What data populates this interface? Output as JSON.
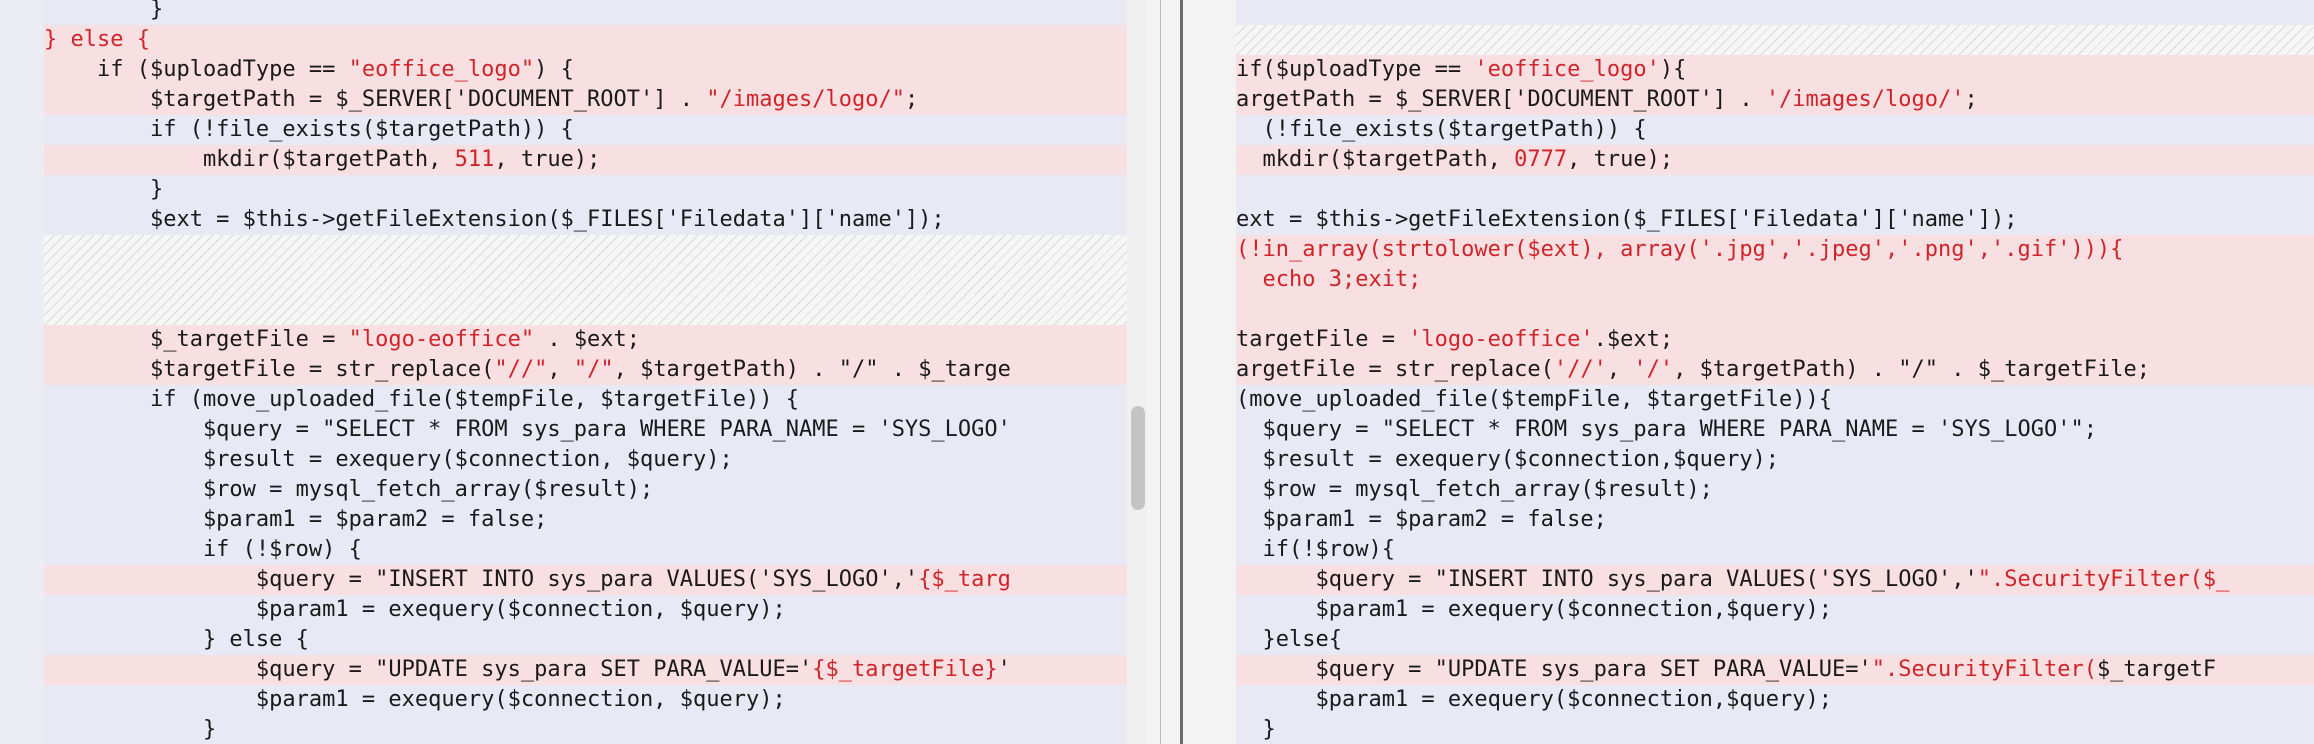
{
  "left": {
    "lines": [
      {
        "type": "plain",
        "segments": [
          {
            "t": "        }"
          }
        ]
      },
      {
        "type": "changed",
        "segments": [
          {
            "t": "} else {",
            "c": "r"
          }
        ]
      },
      {
        "type": "changed",
        "segments": [
          {
            "t": "    if ($uploadType == "
          },
          {
            "t": "\"eoffice_logo\"",
            "c": "r"
          },
          {
            "t": ") {"
          }
        ]
      },
      {
        "type": "changed",
        "segments": [
          {
            "t": "        $targetPath = $_SERVER['DOCUMENT_ROOT'] . "
          },
          {
            "t": "\"/images/logo/\"",
            "c": "r"
          },
          {
            "t": ";"
          }
        ]
      },
      {
        "type": "plain",
        "segments": [
          {
            "t": "        if (!file_exists($targetPath)) {"
          }
        ]
      },
      {
        "type": "changed",
        "segments": [
          {
            "t": "            mkdir($targetPath, "
          },
          {
            "t": "511",
            "c": "r"
          },
          {
            "t": ", true);"
          }
        ]
      },
      {
        "type": "plain",
        "segments": [
          {
            "t": "        }"
          }
        ]
      },
      {
        "type": "plain",
        "segments": [
          {
            "t": "        $ext = $this->getFileExtension($_FILES['Filedata']['name']);"
          }
        ]
      },
      {
        "type": "hatch"
      },
      {
        "type": "hatch"
      },
      {
        "type": "hatch"
      },
      {
        "type": "changed",
        "segments": [
          {
            "t": "        $_targetFile = "
          },
          {
            "t": "\"logo-eoffice\"",
            "c": "r"
          },
          {
            "t": " . $ext;"
          }
        ]
      },
      {
        "type": "changed",
        "segments": [
          {
            "t": "        $targetFile = str_replace("
          },
          {
            "t": "\"//\"",
            "c": "r"
          },
          {
            "t": ", "
          },
          {
            "t": "\"/\"",
            "c": "r"
          },
          {
            "t": ", $targetPath) . \"/\" . $_targe"
          }
        ]
      },
      {
        "type": "plain",
        "segments": [
          {
            "t": "        if (move_uploaded_file($tempFile, $targetFile)) {"
          }
        ]
      },
      {
        "type": "plain",
        "segments": [
          {
            "t": "            $query = \"SELECT * FROM sys_para WHERE PARA_NAME = 'SYS_LOGO'"
          }
        ]
      },
      {
        "type": "plain",
        "segments": [
          {
            "t": "            $result = exequery($connection, $query);"
          }
        ]
      },
      {
        "type": "plain",
        "segments": [
          {
            "t": "            $row = mysql_fetch_array($result);"
          }
        ]
      },
      {
        "type": "plain",
        "segments": [
          {
            "t": "            $param1 = $param2 = false;"
          }
        ]
      },
      {
        "type": "plain",
        "segments": [
          {
            "t": "            if (!$row) {"
          }
        ]
      },
      {
        "type": "changed",
        "segments": [
          {
            "t": "                $query = \"INSERT INTO sys_para VALUES('SYS_LOGO','"
          },
          {
            "t": "{$_targ",
            "c": "r"
          }
        ]
      },
      {
        "type": "plain",
        "segments": [
          {
            "t": "                $param1 = exequery($connection, $query);"
          }
        ]
      },
      {
        "type": "plain",
        "segments": [
          {
            "t": "            } else {"
          }
        ]
      },
      {
        "type": "changed",
        "segments": [
          {
            "t": "                $query = \"UPDATE sys_para SET PARA_VALUE='"
          },
          {
            "t": "{$_targetFile}",
            "c": "r"
          },
          {
            "t": "'"
          }
        ]
      },
      {
        "type": "plain",
        "segments": [
          {
            "t": "                $param1 = exequery($connection, $query);"
          }
        ]
      },
      {
        "type": "plain",
        "segments": [
          {
            "t": "            }"
          }
        ]
      }
    ]
  },
  "right": {
    "lines": [
      {
        "type": "plain",
        "segments": [
          {
            "t": ""
          }
        ]
      },
      {
        "type": "hatch"
      },
      {
        "type": "changed",
        "segments": [
          {
            "t": "if($uploadType == "
          },
          {
            "t": "'eoffice_logo'",
            "c": "r"
          },
          {
            "t": "){"
          }
        ]
      },
      {
        "type": "changed",
        "segments": [
          {
            "t": "argetPath = $_SERVER['DOCUMENT_ROOT'] . "
          },
          {
            "t": "'/images/logo/'",
            "c": "r"
          },
          {
            "t": ";"
          }
        ]
      },
      {
        "type": "plain",
        "segments": [
          {
            "t": "  (!file_exists($targetPath)) {"
          }
        ]
      },
      {
        "type": "changed",
        "segments": [
          {
            "t": "  mkdir($targetPath, "
          },
          {
            "t": "0777",
            "c": "r"
          },
          {
            "t": ", true);"
          }
        ]
      },
      {
        "type": "plain",
        "segments": [
          {
            "t": ""
          }
        ]
      },
      {
        "type": "plain",
        "segments": [
          {
            "t": "ext = $this->getFileExtension($_FILES['Filedata']['name']);"
          }
        ]
      },
      {
        "type": "changed",
        "segments": [
          {
            "t": "(!in_array(strtolower($ext), array('.jpg','.jpeg','.png','.gif'))){",
            "c": "r"
          }
        ]
      },
      {
        "type": "changed",
        "segments": [
          {
            "t": "  echo 3;exit;",
            "c": "r"
          }
        ]
      },
      {
        "type": "changed",
        "segments": [
          {
            "t": ""
          }
        ]
      },
      {
        "type": "changed",
        "segments": [
          {
            "t": "targetFile = "
          },
          {
            "t": "'logo-eoffice'",
            "c": "r"
          },
          {
            "t": ".$ext;"
          }
        ]
      },
      {
        "type": "changed",
        "segments": [
          {
            "t": "argetFile = str_replace("
          },
          {
            "t": "'//'",
            "c": "r"
          },
          {
            "t": ", "
          },
          {
            "t": "'/'",
            "c": "r"
          },
          {
            "t": ", $targetPath) . \"/\" . $_targetFile;"
          }
        ]
      },
      {
        "type": "plain",
        "segments": [
          {
            "t": "(move_uploaded_file($tempFile, $targetFile)){"
          }
        ]
      },
      {
        "type": "plain",
        "segments": [
          {
            "t": "  $query = \"SELECT * FROM sys_para WHERE PARA_NAME = 'SYS_LOGO'\";"
          }
        ]
      },
      {
        "type": "plain",
        "segments": [
          {
            "t": "  $result = exequery($connection,$query);"
          }
        ]
      },
      {
        "type": "plain",
        "segments": [
          {
            "t": "  $row = mysql_fetch_array($result);"
          }
        ]
      },
      {
        "type": "plain",
        "segments": [
          {
            "t": "  $param1 = $param2 = false;"
          }
        ]
      },
      {
        "type": "plain",
        "segments": [
          {
            "t": "  if(!$row){"
          }
        ]
      },
      {
        "type": "changed",
        "segments": [
          {
            "t": "      $query = \"INSERT INTO sys_para VALUES('SYS_LOGO','"
          },
          {
            "t": "\".SecurityFilter($_",
            "c": "r"
          }
        ]
      },
      {
        "type": "plain",
        "segments": [
          {
            "t": "      $param1 = exequery($connection,$query);"
          }
        ]
      },
      {
        "type": "plain",
        "segments": [
          {
            "t": "  }else{"
          }
        ]
      },
      {
        "type": "changed",
        "segments": [
          {
            "t": "      $query = \"UPDATE sys_para SET PARA_VALUE='"
          },
          {
            "t": "\".SecurityFilter(",
            "c": "r"
          },
          {
            "t": "$_targetF"
          }
        ]
      },
      {
        "type": "plain",
        "segments": [
          {
            "t": "      $param1 = exequery($connection,$query);"
          }
        ]
      },
      {
        "type": "plain",
        "segments": [
          {
            "t": "  }"
          }
        ]
      }
    ]
  }
}
